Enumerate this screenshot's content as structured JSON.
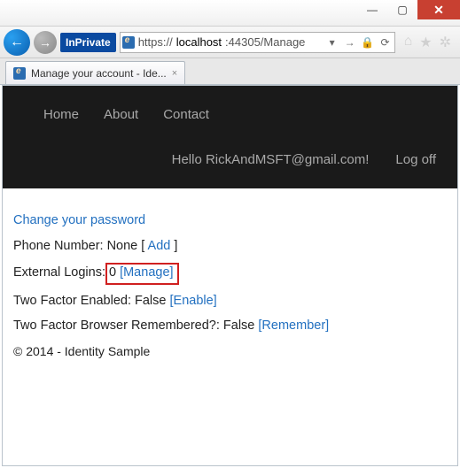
{
  "window": {
    "minimize": "—",
    "maximize": "▢",
    "close": "✕"
  },
  "nav": {
    "back": "←",
    "forward": "→",
    "inprivate": "InPrivate",
    "url_scheme": "https://",
    "url_host": "localhost",
    "url_port_path": ":44305/Manage",
    "dropdown_glyph": "▾",
    "go_glyph": "→",
    "lock_glyph": "🔒",
    "refresh_glyph": "⟳",
    "home_glyph": "⌂",
    "star_glyph": "★",
    "gear_glyph": "✲"
  },
  "tab": {
    "title": "Manage your account - Ide...",
    "close": "×"
  },
  "siteNav": {
    "home": "Home",
    "about": "About",
    "contact": "Contact",
    "greeting": "Hello RickAndMSFT@gmail.com!",
    "logoff": "Log off"
  },
  "content": {
    "change_pw": "Change your password",
    "phone_label": "Phone Number: None [ ",
    "phone_add": "Add",
    "phone_close": " ]",
    "ext_label": "External Logins:",
    "ext_count": " 0 ",
    "ext_manage": "[Manage]",
    "tf_label": "Two Factor Enabled: False ",
    "tf_enable": "[Enable]",
    "tfb_label": "Two Factor Browser Remembered?: False ",
    "tfb_remember": "[Remember]",
    "footer": "© 2014 - Identity Sample"
  }
}
